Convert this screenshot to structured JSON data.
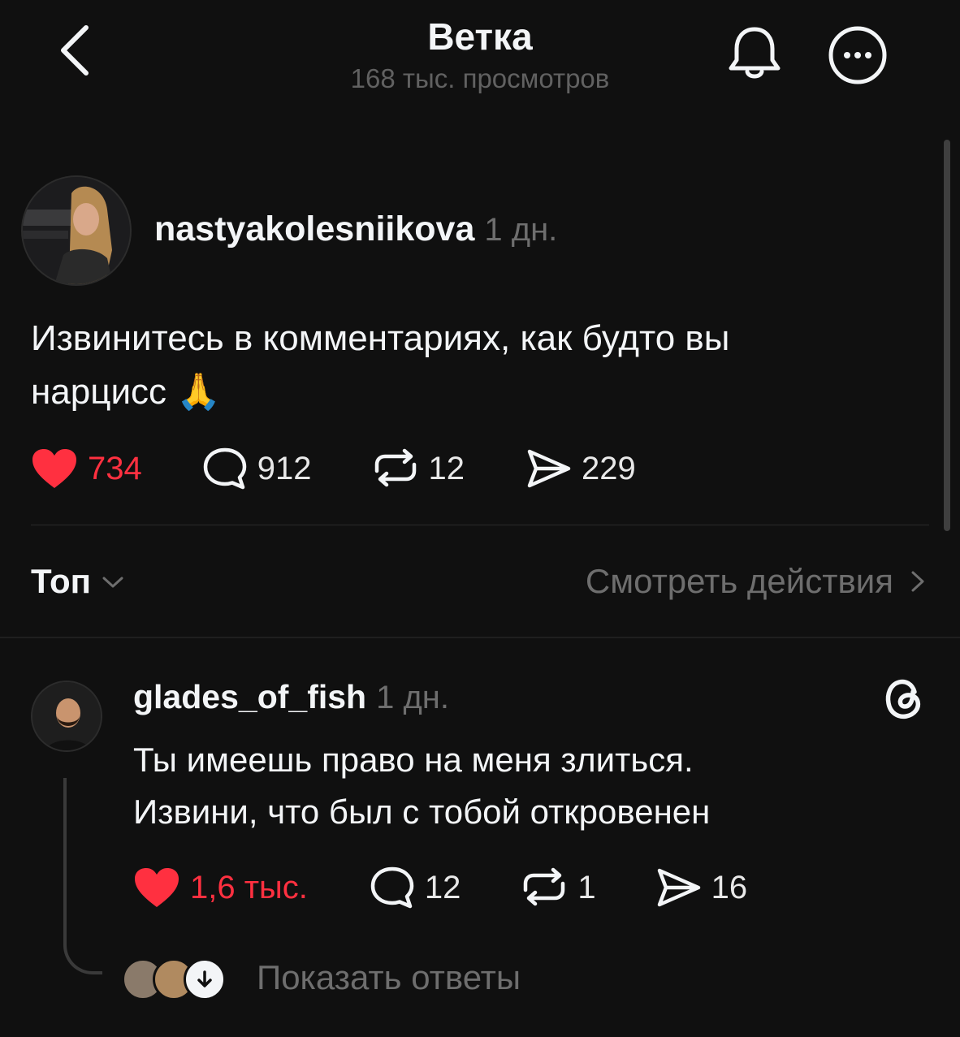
{
  "header": {
    "title": "Ветка",
    "views": "168 тыс. просмотров"
  },
  "post": {
    "username": "nastyakolesniikova",
    "time": "1 дн.",
    "text_line1": "Извинитесь в комментариях, как будто вы",
    "text_line2": "нарцисс",
    "emoji": "🙏",
    "likes": "734",
    "comments": "912",
    "reposts": "12",
    "shares": "229"
  },
  "filter": {
    "sort_label": "Топ",
    "activity_label": "Смотреть действия"
  },
  "reply": {
    "username": "glades_of_fish",
    "time": "1 дн.",
    "text_line1": "Ты имеешь право на меня злиться.",
    "text_line2": "Извини, что был с тобой откровенен",
    "likes": "1,6 тыс.",
    "comments": "12",
    "reposts": "1",
    "shares": "16",
    "show_replies_label": "Показать ответы"
  },
  "colors": {
    "background": "#101010",
    "text": "#f3f5f7",
    "muted": "#6e6e6e",
    "like": "#ff3040"
  }
}
